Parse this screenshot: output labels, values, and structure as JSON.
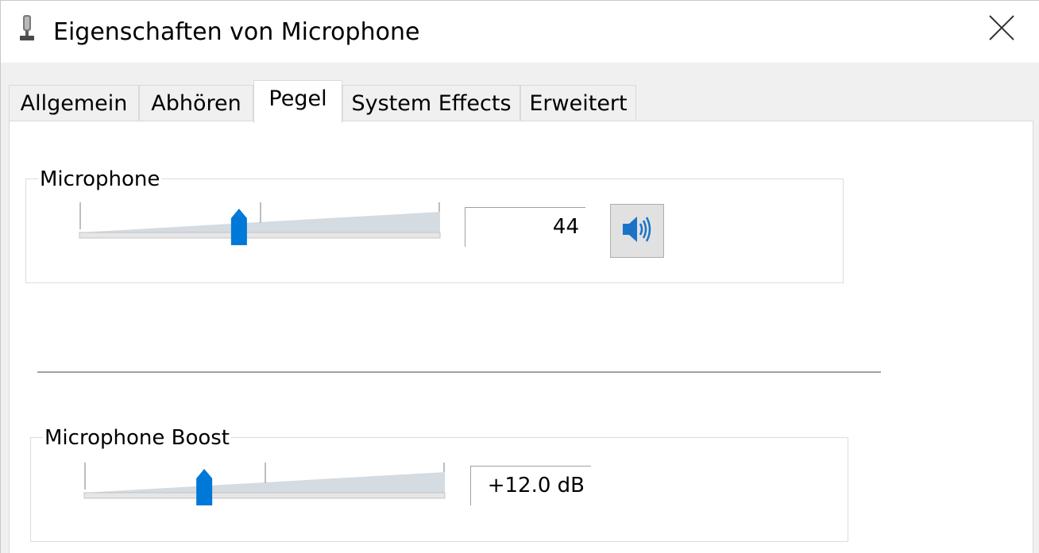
{
  "window": {
    "title": "Eigenschaften von Microphone",
    "icon": "microphone-icon",
    "close_icon": "close-icon"
  },
  "tabs": [
    {
      "label": "Allgemein",
      "active": false
    },
    {
      "label": "Abhören",
      "active": false
    },
    {
      "label": "Pegel",
      "active": true
    },
    {
      "label": "System Effects",
      "active": false
    },
    {
      "label": "Erweitert",
      "active": false
    }
  ],
  "microphone_group": {
    "label": "Microphone",
    "value": "44",
    "slider_level_percent": 44,
    "speaker_icon": "speaker-volume-icon"
  },
  "boost_group": {
    "label": "Microphone Boost",
    "value": "+12.0 dB",
    "slider_level_percent": 33
  },
  "colors": {
    "accent": "#0078d7",
    "track": "#d4dbe1",
    "background": "#f0f0f0"
  }
}
